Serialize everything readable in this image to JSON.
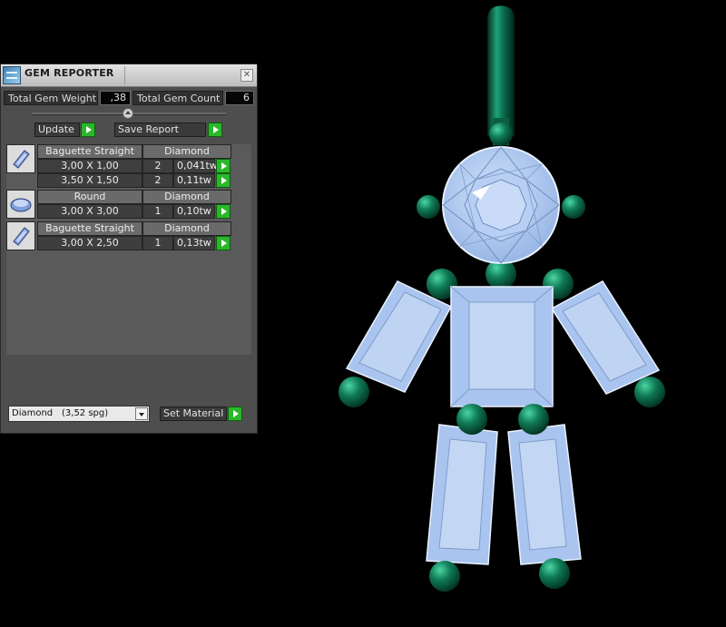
{
  "panel": {
    "title": "GEM REPORTER",
    "close_glyph": "✕",
    "total_weight_label": "Total Gem Weight",
    "total_weight_value": ",38",
    "total_count_label": "Total Gem Count",
    "total_count_value": "6",
    "update_label": "Update",
    "save_report_label": "Save Report",
    "icon_names": [
      "gem-reporter-icon",
      "close-icon",
      "divider-knob-icon",
      "play-icon",
      "baguette-icon",
      "round-gem-icon",
      "chevron-down-icon"
    ]
  },
  "gems": [
    {
      "shape": "Baguette Straight",
      "material": "Diamond",
      "rows": [
        {
          "size": "3,00 X 1,00",
          "count": "2",
          "weight": "0,041tw"
        },
        {
          "size": "3,50 X 1,50",
          "count": "2",
          "weight": "0,11tw"
        }
      ]
    },
    {
      "shape": "Round",
      "material": "Diamond",
      "rows": [
        {
          "size": "3,00 X 3,00",
          "count": "1",
          "weight": "0,10tw"
        }
      ]
    },
    {
      "shape": "Baguette Straight",
      "material": "Diamond",
      "rows": [
        {
          "size": "3,00 X 2,50",
          "count": "1",
          "weight": "0,13tw"
        }
      ]
    }
  ],
  "material": {
    "name": "Diamond",
    "spg": "(3,52 spg)",
    "set_label": "Set Material"
  },
  "colors": {
    "gem_fill": "#a9c4ee",
    "metal_green": "#0d6a4c",
    "play_button": "#2bb62b",
    "panel_bg": "#4e4e4e"
  }
}
